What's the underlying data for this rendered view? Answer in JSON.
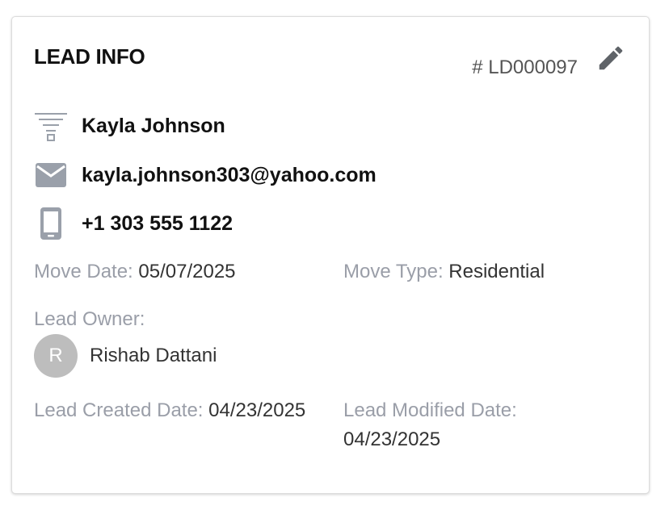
{
  "card": {
    "title": "LEAD INFO",
    "lead_id": "# LD000097",
    "edit_icon": "pencil-icon"
  },
  "contact": {
    "name": "Kayla Johnson",
    "name_icon": "funnel-icon",
    "email": "kayla.johnson303@yahoo.com",
    "email_icon": "envelope-icon",
    "phone": "+1 303 555 1122",
    "phone_icon": "smartphone-icon"
  },
  "details": {
    "move_date_label": "Move Date:",
    "move_date": "05/07/2025",
    "move_type_label": "Move Type:",
    "move_type": "Residential",
    "lead_owner_label": "Lead Owner:",
    "owner_initial": "R",
    "owner_name": "Rishab Dattani",
    "created_label": "Lead Created Date:",
    "created_date": "04/23/2025",
    "modified_label": "Lead Modified Date:",
    "modified_date": "04/23/2025"
  },
  "colors": {
    "label": "#9a9ea8",
    "icon": "#9aa0aa",
    "avatar_bg": "#bdbdbd"
  }
}
